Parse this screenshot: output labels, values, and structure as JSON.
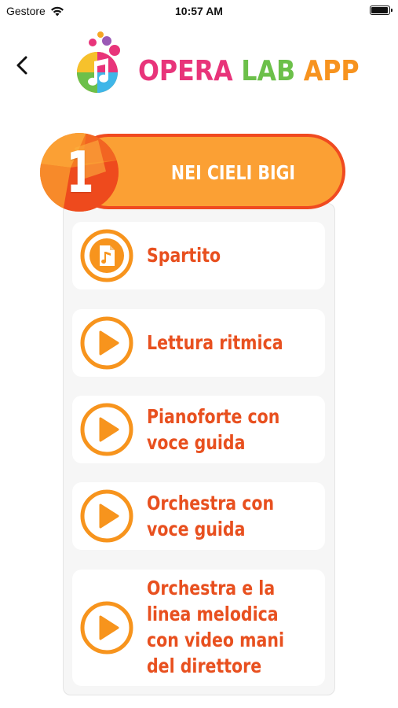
{
  "status_bar": {
    "carrier": "Gestore",
    "time": "10:57 AM",
    "battery_level": 0.95
  },
  "header": {
    "back_icon": "chevron-left-icon",
    "brand_words": [
      "OPERA",
      "LAB",
      "APP"
    ],
    "brand_colors": [
      "#e8347a",
      "#6cc04a",
      "#f7931e"
    ]
  },
  "section": {
    "number": "1",
    "title": "NEI CIELI BIGI",
    "colors": {
      "pill": "#fba034",
      "pill_border": "#f04a20",
      "text": "#e8501f"
    }
  },
  "items": [
    {
      "icon": "music-sheet-icon",
      "lines": [
        "Spartito"
      ]
    },
    {
      "icon": "play-icon",
      "lines": [
        "Lettura ritmica"
      ]
    },
    {
      "icon": "play-icon",
      "lines": [
        "Pianoforte con",
        "voce guida"
      ]
    },
    {
      "icon": "play-icon",
      "lines": [
        "Orchestra con",
        "voce guida"
      ]
    },
    {
      "icon": "play-icon",
      "lines": [
        "Orchestra e la",
        "linea melodica",
        "con video mani",
        "del direttore"
      ]
    }
  ]
}
